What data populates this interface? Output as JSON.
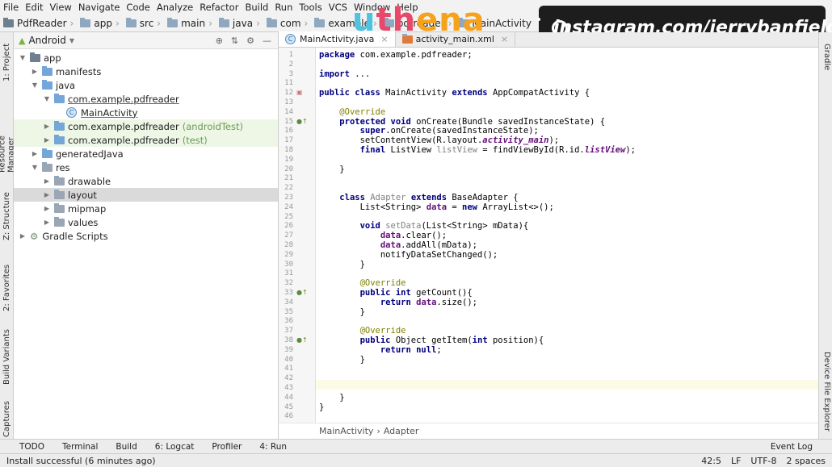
{
  "menu": [
    "File",
    "Edit",
    "View",
    "Navigate",
    "Code",
    "Analyze",
    "Refactor",
    "Build",
    "Run",
    "Tools",
    "VCS",
    "Window",
    "Help"
  ],
  "breadcrumbs": [
    "PdfReader",
    "app",
    "src",
    "main",
    "java",
    "com",
    "example",
    "pdfreader",
    "MainActivity"
  ],
  "overlay": {
    "logo_a": "u",
    "logo_b": "th",
    "logo_c": "ena",
    "instagram": "instagram.com/jerrybanfield"
  },
  "left_tabs": [
    "1: Project",
    "Resource Manager",
    "Z: Structure",
    "2: Favorites",
    "Build Variants",
    "Captures"
  ],
  "right_tabs": [
    "Gradle",
    "Device File Explorer"
  ],
  "project": {
    "view": "Android",
    "tree": [
      {
        "label": "app",
        "indent": 0,
        "open": true,
        "icon": "folder-dark"
      },
      {
        "label": "manifests",
        "indent": 1,
        "open": false,
        "icon": "folder-blue"
      },
      {
        "label": "java",
        "indent": 1,
        "open": true,
        "icon": "folder-blue"
      },
      {
        "label": "com.example.pdfreader",
        "indent": 2,
        "open": true,
        "icon": "package",
        "underline": true
      },
      {
        "label": "MainActivity",
        "indent": 3,
        "icon": "class",
        "underline": true
      },
      {
        "label": "com.example.pdfreader",
        "suffix": "(androidTest)",
        "indent": 2,
        "open": false,
        "icon": "package",
        "test": true
      },
      {
        "label": "com.example.pdfreader",
        "suffix": "(test)",
        "indent": 2,
        "open": false,
        "icon": "package",
        "test": true
      },
      {
        "label": "generatedJava",
        "indent": 1,
        "open": false,
        "icon": "folder-blue"
      },
      {
        "label": "res",
        "indent": 1,
        "open": true,
        "icon": "folder-res"
      },
      {
        "label": "drawable",
        "indent": 2,
        "open": false,
        "icon": "folder-res"
      },
      {
        "label": "layout",
        "indent": 2,
        "open": false,
        "icon": "folder-res",
        "selected": true
      },
      {
        "label": "mipmap",
        "indent": 2,
        "open": false,
        "icon": "folder-res"
      },
      {
        "label": "values",
        "indent": 2,
        "open": false,
        "icon": "folder-res"
      },
      {
        "label": "Gradle Scripts",
        "indent": 0,
        "open": false,
        "icon": "gradle"
      }
    ]
  },
  "tabs": [
    {
      "label": "MainActivity.java",
      "active": true
    },
    {
      "label": "activity_main.xml",
      "active": false
    }
  ],
  "code": [
    {
      "n": "1",
      "t": "<span class='kw'>package</span> com.example.pdfreader;"
    },
    {
      "n": "2",
      "t": ""
    },
    {
      "n": "3",
      "t": "<span class='kw'>import</span> ..."
    },
    {
      "n": "11",
      "t": ""
    },
    {
      "n": "12",
      "t": "<span class='kw'>public class</span> MainActivity <span class='kw'>extends</span> AppCompatActivity {"
    },
    {
      "n": "13",
      "t": ""
    },
    {
      "n": "14",
      "t": "    <span class='an'>@Override</span>"
    },
    {
      "n": "15",
      "t": "    <span class='kw'>protected void</span> onCreate(Bundle savedInstanceState) {"
    },
    {
      "n": "16",
      "t": "        <span class='kw'>super</span>.onCreate(savedInstanceState);"
    },
    {
      "n": "17",
      "t": "        setContentView(R.layout.<span class='fld it'>activity_main</span>);"
    },
    {
      "n": "18",
      "t": "        <span class='kw'>final</span> ListView <span class='unused'>listView</span> = findViewById(R.id.<span class='fld it'>listView</span>);"
    },
    {
      "n": "19",
      "t": ""
    },
    {
      "n": "20",
      "t": "    }"
    },
    {
      "n": "21",
      "t": ""
    },
    {
      "n": "22",
      "t": ""
    },
    {
      "n": "23",
      "t": "    <span class='kw'>class</span> <span class='unused'>Adapter</span> <span class='kw'>extends</span> BaseAdapter {"
    },
    {
      "n": "24",
      "t": "        List&lt;String&gt; <span class='fld'>data</span> = <span class='kw'>new</span> ArrayList&lt;&gt;();"
    },
    {
      "n": "25",
      "t": ""
    },
    {
      "n": "26",
      "t": "        <span class='kw'>void</span> <span class='unused'>setData</span>(List&lt;String&gt; mData){"
    },
    {
      "n": "27",
      "t": "            <span class='fld'>data</span>.clear();"
    },
    {
      "n": "28",
      "t": "            <span class='fld'>data</span>.addAll(mData);"
    },
    {
      "n": "29",
      "t": "            notifyDataSetChanged();"
    },
    {
      "n": "30",
      "t": "        }"
    },
    {
      "n": "31",
      "t": ""
    },
    {
      "n": "32",
      "t": "        <span class='an'>@Override</span>"
    },
    {
      "n": "33",
      "t": "        <span class='kw'>public int</span> getCount(){"
    },
    {
      "n": "34",
      "t": "            <span class='kw'>return</span> <span class='fld'>data</span>.size();"
    },
    {
      "n": "35",
      "t": "        }"
    },
    {
      "n": "36",
      "t": ""
    },
    {
      "n": "37",
      "t": "        <span class='an'>@Override</span>"
    },
    {
      "n": "38",
      "t": "        <span class='kw'>public</span> Object getItem(<span class='kw'>int</span> position){"
    },
    {
      "n": "39",
      "t": "            <span class='kw'>return null</span>;"
    },
    {
      "n": "40",
      "t": "        }"
    },
    {
      "n": "41",
      "t": ""
    },
    {
      "n": "42",
      "t": ""
    },
    {
      "n": "43",
      "t": ""
    },
    {
      "n": "44",
      "t": "    }"
    },
    {
      "n": "45",
      "t": "}"
    },
    {
      "n": "46",
      "t": ""
    }
  ],
  "code_breadcrumb": [
    "MainActivity",
    "Adapter"
  ],
  "bottom_tabs": [
    "TODO",
    "Terminal",
    "Build",
    "6: Logcat",
    "Profiler",
    "4: Run"
  ],
  "event_log": "Event Log",
  "status": {
    "message": "Install successful (6 minutes ago)",
    "position": "42:5",
    "line_sep": "LF",
    "encoding": "UTF-8",
    "indent": "2 spaces"
  }
}
